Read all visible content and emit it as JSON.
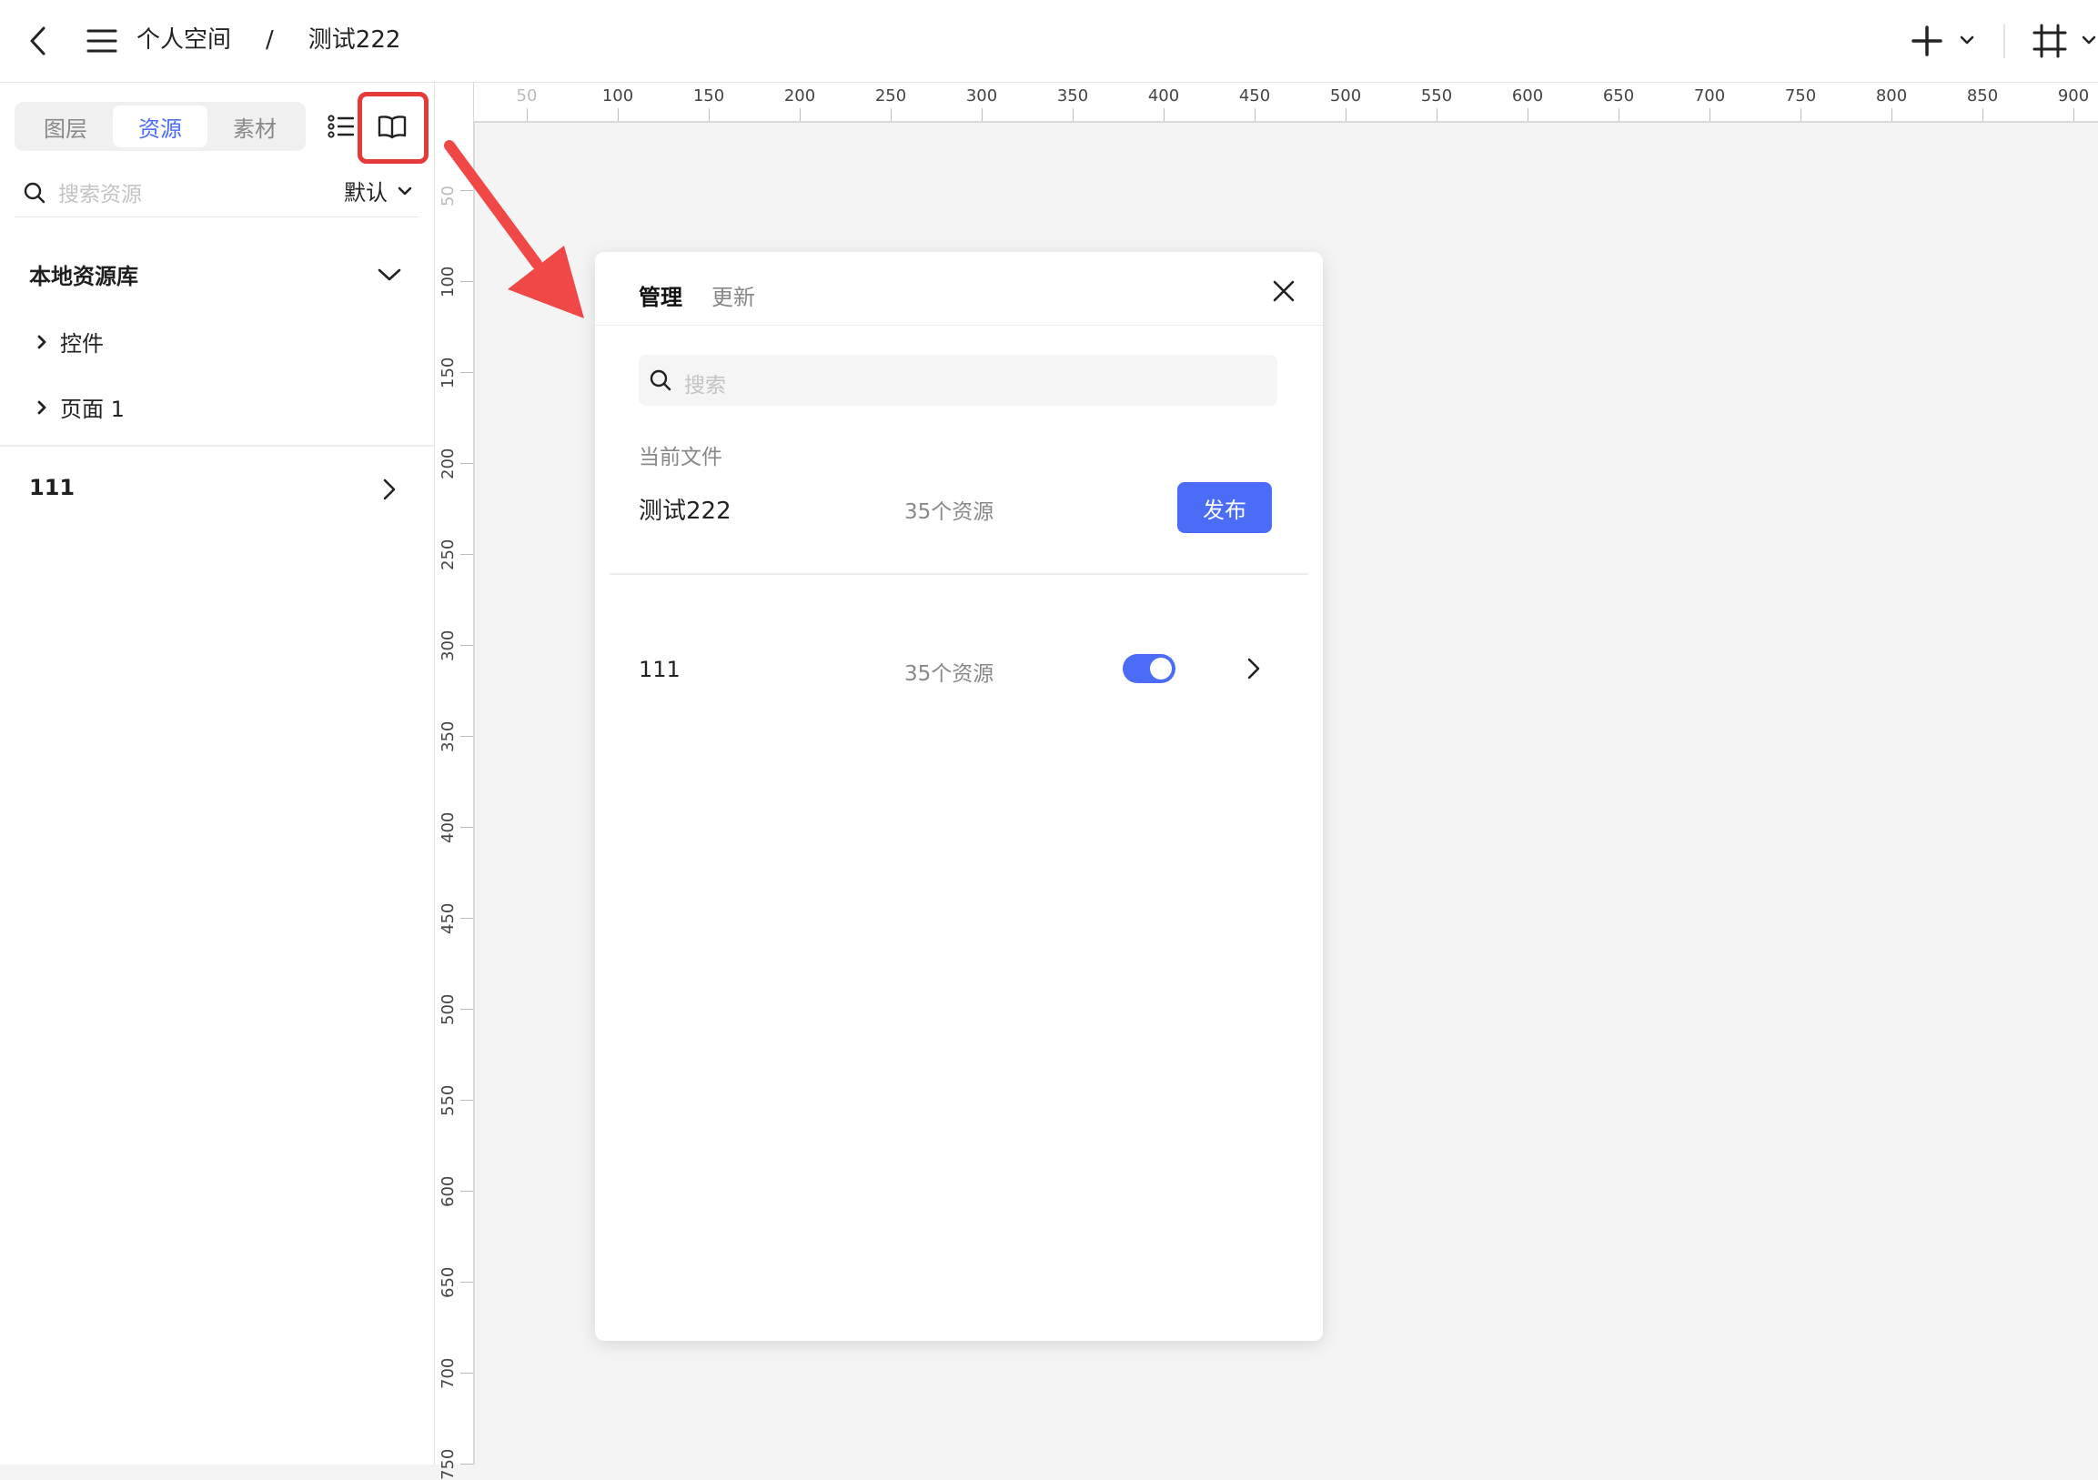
{
  "topbar": {
    "breadcrumb": [
      "个人空间",
      "测试222"
    ],
    "separator": "/"
  },
  "left_panel": {
    "tabs": [
      {
        "label": "图层",
        "active": false
      },
      {
        "label": "资源",
        "active": true
      },
      {
        "label": "素材",
        "active": false
      }
    ],
    "search_placeholder": "搜索资源",
    "sort_label": "默认",
    "section_title": "本地资源库",
    "tree_items": [
      "控件",
      "页面 1"
    ],
    "library_entry": "111"
  },
  "rulers": {
    "horizontal": [
      "50",
      "100",
      "150",
      "200",
      "250",
      "300",
      "350",
      "400",
      "450",
      "500",
      "550",
      "600",
      "650",
      "700",
      "750",
      "800",
      "850",
      "900"
    ],
    "vertical": [
      "50",
      "100",
      "150",
      "200",
      "250",
      "300",
      "350",
      "400",
      "450",
      "500",
      "550",
      "600",
      "650",
      "700",
      "750"
    ]
  },
  "dialog": {
    "tabs": [
      "管理",
      "更新"
    ],
    "search_placeholder": "搜索",
    "current_file_label": "当前文件",
    "current_file": {
      "name": "测试222",
      "count": "35个资源",
      "action": "发布"
    },
    "library": {
      "name": "111",
      "count": "35个资源",
      "enabled": true
    }
  },
  "colors": {
    "accent": "#4a6cf7",
    "highlight": "#e53a3a",
    "arrow": "#f04747"
  }
}
